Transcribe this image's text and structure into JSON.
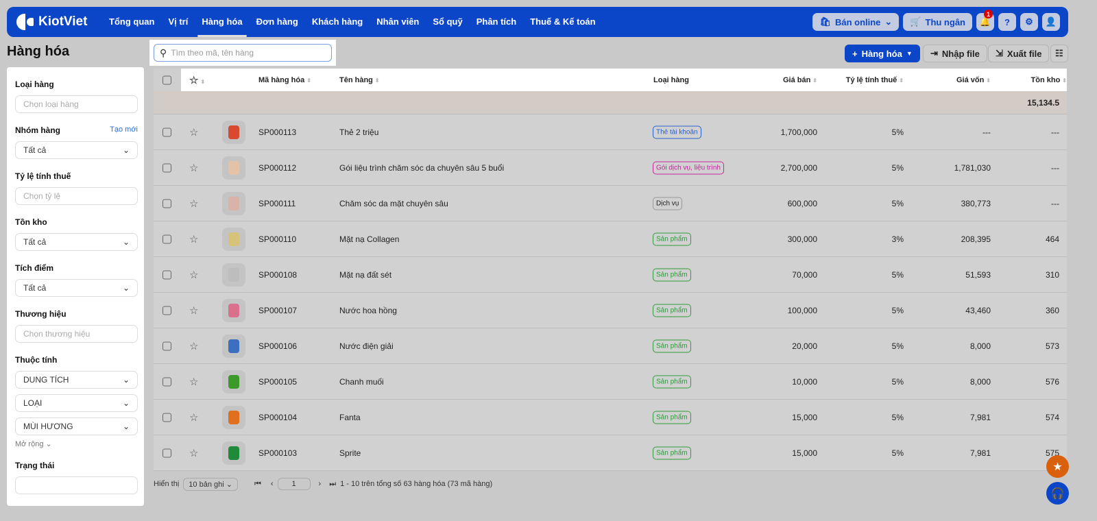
{
  "nav": {
    "brand": "KiotViet",
    "items": [
      "Tổng quan",
      "Vị trí",
      "Hàng hóa",
      "Đơn hàng",
      "Khách hàng",
      "Nhân viên",
      "Sổ quỹ",
      "Phân tích",
      "Thuế & Kế toán"
    ],
    "online": "Bán online",
    "cashier": "Thu ngân",
    "notif_count": "1"
  },
  "page": {
    "title": "Hàng hóa",
    "search_placeholder": "Tìm theo mã, tên hàng",
    "add": "Hàng hóa",
    "import": "Nhập file",
    "export": "Xuất file"
  },
  "sidebar": {
    "type_label": "Loại hàng",
    "type_ph": "Chọn loại hàng",
    "group_label": "Nhóm hàng",
    "group_new": "Tạo mới",
    "group_val": "Tất cả",
    "tax_label": "Tỷ lệ tính thuế",
    "tax_ph": "Chọn tỷ lệ",
    "stock_label": "Tồn kho",
    "stock_val": "Tất cả",
    "points_label": "Tích điểm",
    "points_val": "Tất cả",
    "brand_label": "Thương hiệu",
    "brand_ph": "Chọn thương hiệu",
    "attr_label": "Thuộc tính",
    "attrs": [
      "DUNG TÍCH",
      "LOẠI",
      "MÙI HƯƠNG"
    ],
    "more": "Mở rộng",
    "status_label": "Trạng thái"
  },
  "table": {
    "headers": {
      "code": "Mã hàng hóa",
      "name": "Tên hàng",
      "type": "Loại hàng",
      "price": "Giá bán",
      "tax": "Tỷ lệ tính thuế",
      "cost": "Giá vốn",
      "stock": "Tồn kho"
    },
    "total_stock": "15,134.5",
    "rows": [
      {
        "code": "SP000113",
        "name": "Thẻ 2 triệu",
        "type": "Thẻ tài khoản",
        "tc": "#2a5fd0",
        "price": "1,700,000",
        "tax": "5%",
        "cost": "---",
        "stock": "---",
        "img": "#d8492f"
      },
      {
        "code": "SP000112",
        "name": "Gói liệu trình chăm sóc da chuyên sâu 5 buổi",
        "type": "Gói dịch vụ, liệu trình",
        "tc": "#c3279a",
        "price": "2,700,000",
        "tax": "5%",
        "cost": "1,781,030",
        "stock": "---",
        "img": "#e3c2a8"
      },
      {
        "code": "SP000111",
        "name": "Chăm sóc da mặt chuyên sâu",
        "type": "Dịch vụ",
        "tc": "#999",
        "price": "600,000",
        "tax": "5%",
        "cost": "380,773",
        "stock": "---",
        "img": "#d9b3a8"
      },
      {
        "code": "SP000110",
        "name": "Mặt nạ Collagen",
        "type": "Sản phẩm",
        "tc": "#2f9a3c",
        "price": "300,000",
        "tax": "3%",
        "cost": "208,395",
        "stock": "464",
        "img": "#d7c27a"
      },
      {
        "code": "SP000108",
        "name": "Mặt nạ đất sét",
        "type": "Sản phẩm",
        "tc": "#2f9a3c",
        "price": "70,000",
        "tax": "5%",
        "cost": "51,593",
        "stock": "310",
        "img": "#bdbdbd"
      },
      {
        "code": "SP000107",
        "name": "Nước hoa hồng",
        "type": "Sản phẩm",
        "tc": "#2f9a3c",
        "price": "100,000",
        "tax": "5%",
        "cost": "43,460",
        "stock": "360",
        "img": "#d9708c"
      },
      {
        "code": "SP000106",
        "name": "Nước điện giải",
        "type": "Sản phẩm",
        "tc": "#2f9a3c",
        "price": "20,000",
        "tax": "5%",
        "cost": "8,000",
        "stock": "573",
        "img": "#3d6fc0"
      },
      {
        "code": "SP000105",
        "name": "Chanh muối",
        "type": "Sản phẩm",
        "tc": "#2f9a3c",
        "price": "10,000",
        "tax": "5%",
        "cost": "8,000",
        "stock": "576",
        "img": "#3c9a2a"
      },
      {
        "code": "SP000104",
        "name": "Fanta",
        "type": "Sản phẩm",
        "tc": "#2f9a3c",
        "price": "15,000",
        "tax": "5%",
        "cost": "7,981",
        "stock": "574",
        "img": "#e0701e"
      },
      {
        "code": "SP000103",
        "name": "Sprite",
        "type": "Sản phẩm",
        "tc": "#2f9a3c",
        "price": "15,000",
        "tax": "5%",
        "cost": "7,981",
        "stock": "575",
        "img": "#1f8a3a"
      }
    ]
  },
  "footer": {
    "show": "Hiển thị",
    "per_page": "10 bản ghi",
    "page": "1",
    "summary": "1 - 10 trên tổng số 63 hàng hóa (73 mã hàng)"
  }
}
